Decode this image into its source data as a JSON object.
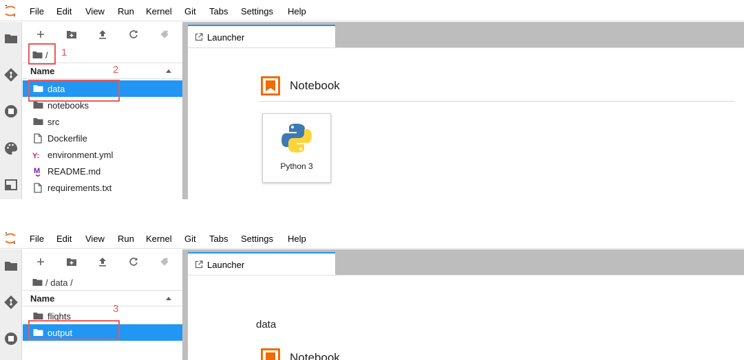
{
  "menu": [
    "File",
    "Edit",
    "View",
    "Run",
    "Kernel",
    "Git",
    "Tabs",
    "Settings",
    "Help"
  ],
  "colors": {
    "accent": "#2196f3",
    "annotation": "#e85a5a",
    "notebook_icon": "#ef6c00"
  },
  "toolbar_icons": [
    "new-launcher-icon",
    "new-folder-icon",
    "upload-icon",
    "refresh-icon",
    "git-clone-icon"
  ],
  "sidebar_icons": [
    "folder-icon",
    "git-icon",
    "running-icon",
    "palette-icon",
    "tabs-icon"
  ],
  "screen1": {
    "breadcrumb": "/",
    "header": "Name",
    "files": [
      {
        "name": "data",
        "icon": "folder-icon",
        "selected": true
      },
      {
        "name": "notebooks",
        "icon": "folder-icon",
        "selected": false
      },
      {
        "name": "src",
        "icon": "folder-icon",
        "selected": false
      },
      {
        "name": "Dockerfile",
        "icon": "file-icon",
        "selected": false
      },
      {
        "name": "environment.yml",
        "icon": "yaml-icon",
        "selected": false
      },
      {
        "name": "README.md",
        "icon": "markdown-icon",
        "selected": false
      },
      {
        "name": "requirements.txt",
        "icon": "file-icon",
        "selected": false
      }
    ],
    "tab_label": "Launcher",
    "section": "Notebook",
    "kernel": "Python 3",
    "annotations": [
      "1",
      "2"
    ]
  },
  "screen2": {
    "breadcrumb": "/ data /",
    "header": "Name",
    "files": [
      {
        "name": "flights",
        "icon": "folder-icon",
        "selected": false
      },
      {
        "name": "output",
        "icon": "folder-icon",
        "selected": true
      }
    ],
    "tab_label": "Launcher",
    "cwd": "data",
    "section": "Notebook",
    "annotations": [
      "3"
    ]
  }
}
